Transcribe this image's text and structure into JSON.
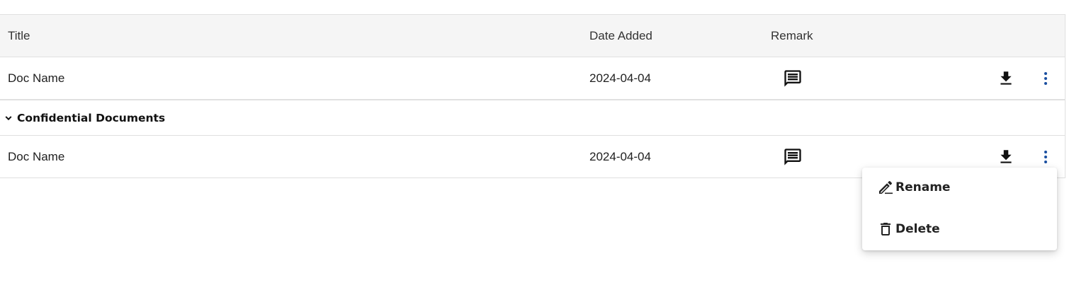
{
  "table": {
    "headers": {
      "title": "Title",
      "date_added": "Date Added",
      "remark": "Remark"
    },
    "rows": [
      {
        "title": "Doc Name",
        "date_added": "2024-04-04"
      },
      {
        "title": "Doc Name",
        "date_added": "2024-04-04"
      }
    ],
    "group": {
      "label": "Confidential Documents",
      "expanded": true
    }
  },
  "context_menu": {
    "items": [
      {
        "label": "Rename",
        "icon": "edit-pencil-icon"
      },
      {
        "label": "Delete",
        "icon": "trash-icon"
      }
    ]
  },
  "colors": {
    "header_bg": "#f5f5f5",
    "border": "#e0e0e0",
    "more_icon": "#1a4fa0",
    "text": "#1f1f1f"
  }
}
